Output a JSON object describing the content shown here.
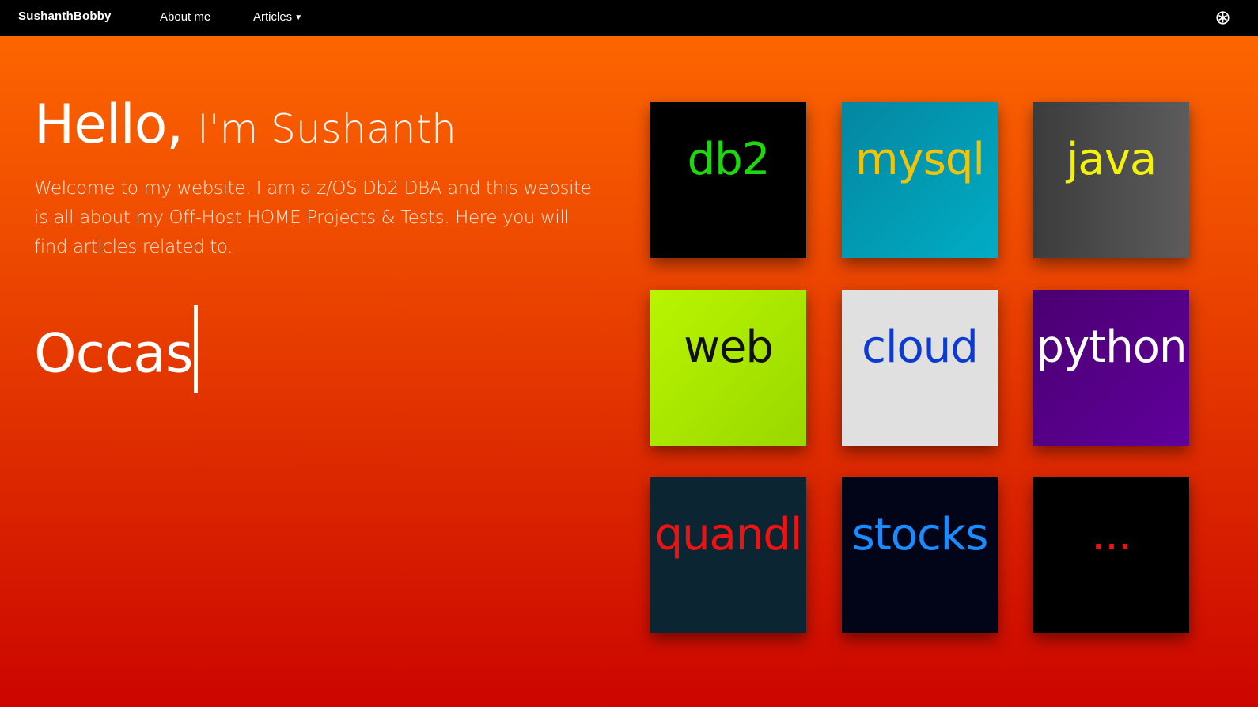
{
  "navbar": {
    "brand": "SushanthBobby",
    "about": "About me",
    "articles": "Articles",
    "settings_icon": "settings-icon"
  },
  "hero": {
    "hello": "Hello,",
    "name": "I'm Sushanth",
    "intro": "Welcome to my website. I am a z/OS Db2 DBA and this website is all about my Off-Host HOME Projects & Tests. Here you will find articles related to.",
    "typed": "Occas"
  },
  "tiles": {
    "db2": {
      "label": "db2",
      "bg": "#000000",
      "color": "#1ed70d"
    },
    "mysql": {
      "label": "mysql",
      "bg": "#00a4bd",
      "color": "#f0c40c"
    },
    "java": {
      "label": "java",
      "bg": "#4a4a4a",
      "color": "#f2f20c"
    },
    "web": {
      "label": "web",
      "bg": "#aee800",
      "color": "#101010"
    },
    "cloud": {
      "label": "cloud",
      "bg": "#e0e0e0",
      "color": "#0b3bd2"
    },
    "python": {
      "label": "python",
      "bg": "#560088",
      "color": "#ffffff"
    },
    "quandl": {
      "label": "quandl",
      "bg": "#0c2533",
      "color": "#ee1313"
    },
    "stocks": {
      "label": "stocks",
      "bg": "#020418",
      "color": "#1a8cff"
    },
    "more": {
      "label": "...",
      "bg": "#000000",
      "color": "#ee1313"
    }
  },
  "colors": {
    "gradient_top": "#ff6a00",
    "gradient_bottom": "#cc0500",
    "navbar_bg": "#000000"
  }
}
